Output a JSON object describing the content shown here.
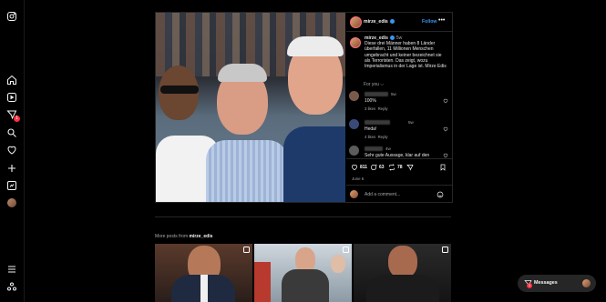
{
  "post": {
    "username": "mirze_edis",
    "follow_label": "Follow",
    "more_label": "•••",
    "caption_username": "mirze_edis",
    "caption_time": "5w",
    "caption_text": "Diese drei Männer haben 8 Länder überfallen, 11 Millionen Menschen umgebracht und keiner bezeichnet sie als Terroristen. Das zeigt, wozu Imperialismus in der Lage ist. Mirze Edis",
    "for_you_label": "For you ⌵",
    "comments": [
      {
        "time": "5w",
        "text": "100%",
        "likes": "3 likes",
        "reply": "Reply"
      },
      {
        "time": "5w",
        "text": "Heda!",
        "likes": "4 likes",
        "reply": "Reply"
      },
      {
        "time": "4w",
        "text": "Sehr gute Aussage, klar auf den",
        "likes": "",
        "reply": ""
      }
    ],
    "actions": {
      "likes_count": "811",
      "comments_count": "63",
      "reposts_count": "78"
    },
    "date": "June 6",
    "add_comment_placeholder": "Add a comment..."
  },
  "more_posts": {
    "prefix": "More posts from",
    "username": "mirze_edis"
  },
  "messages": {
    "label": "Messages",
    "badge": "1"
  },
  "sidebar": {
    "notification_badge": "1"
  },
  "colors": {
    "accent": "#3797f0",
    "badge": "#ff3040",
    "border": "#262626"
  }
}
